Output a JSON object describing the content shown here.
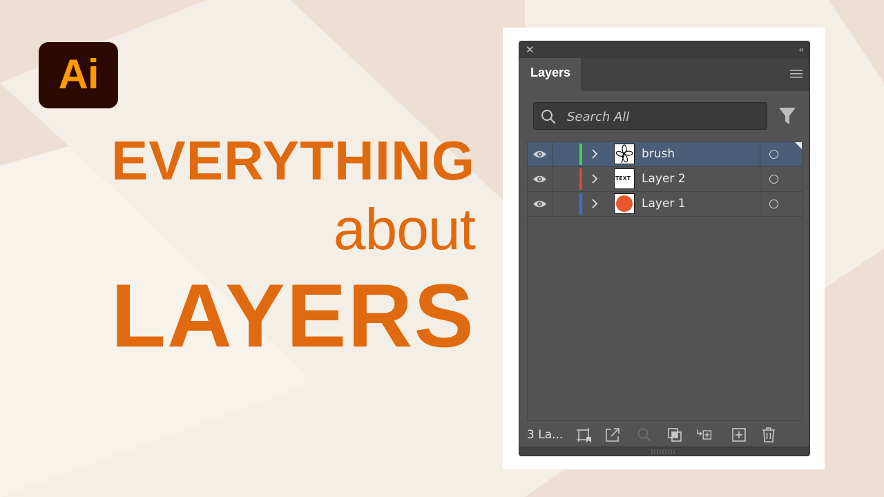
{
  "logo": {
    "text": "Ai"
  },
  "headline": {
    "line1": "EVERYTHING",
    "line2": "about",
    "line3": "LAYERS"
  },
  "panel": {
    "close_symbol": "✕",
    "collapse_symbol": "‹‹",
    "tab_label": "Layers",
    "search": {
      "placeholder": "Search All",
      "value": ""
    },
    "layers": [
      {
        "name": "brush",
        "color": "#3fd44a",
        "visible": true,
        "selected": true,
        "thumbnail": "flower-sketch"
      },
      {
        "name": "Layer 2",
        "color": "#e0433a",
        "visible": true,
        "selected": false,
        "thumbnail": "text-box",
        "thumb_text": "TEXT"
      },
      {
        "name": "Layer 1",
        "color": "#3d6ae0",
        "visible": true,
        "selected": false,
        "thumbnail": "orange-circle"
      }
    ],
    "footer": {
      "count_label": "3 La..."
    }
  },
  "colors": {
    "accent": "#e06a0f",
    "logo_bg": "#2a0a00",
    "logo_text": "#ff9a00",
    "panel_bg": "#535353",
    "selection": "#4a5d76"
  }
}
